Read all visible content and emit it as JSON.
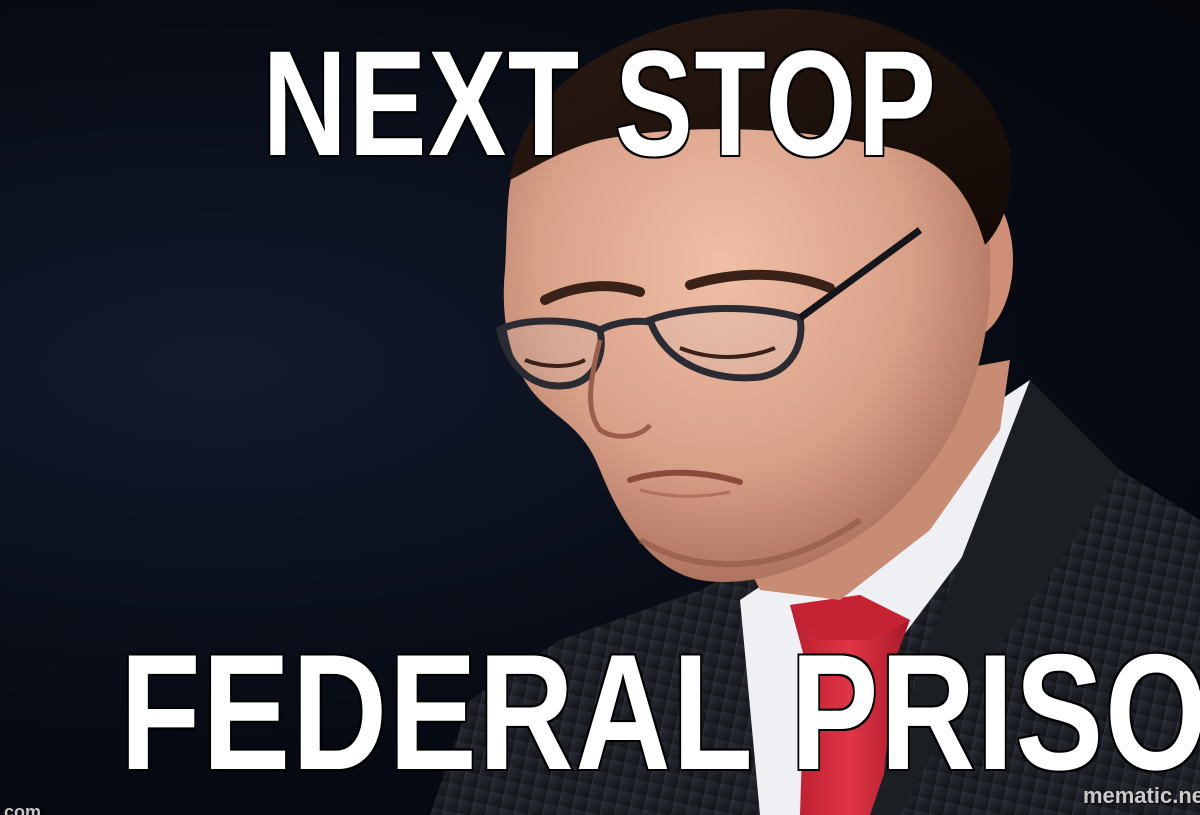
{
  "meme": {
    "top_text": "NEXT STOP",
    "bottom_text": "FEDERAL PRISON",
    "watermark_right": "mematic.ne",
    "watermark_left": "p.com"
  },
  "colors": {
    "background": "#05070d",
    "caption": "#ffffff",
    "caption_outline": "#000000",
    "tie": "#d6283a",
    "suit": "#1e2126",
    "shirt": "#eef0f4",
    "skin": "#d9a088"
  }
}
